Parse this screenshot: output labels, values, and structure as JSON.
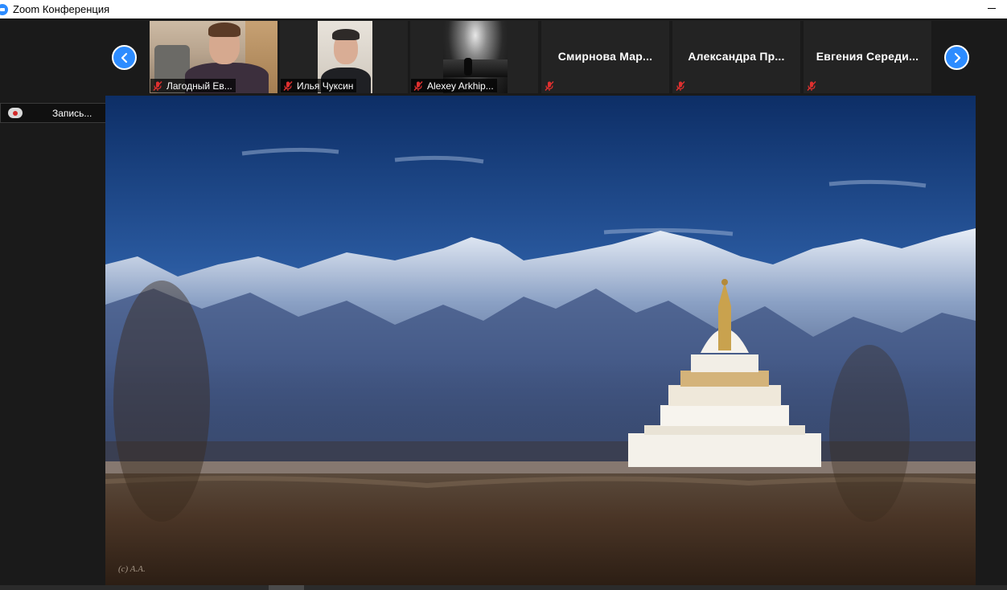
{
  "window": {
    "title": "Zoom Конференция"
  },
  "participants": [
    {
      "name": "Лагодный Ев...",
      "muted": true,
      "video": true
    },
    {
      "name": "Илья Чуксин",
      "muted": true,
      "video": true
    },
    {
      "name": "Alexey Arkhip...",
      "muted": true,
      "video": true
    },
    {
      "name": "Смирнова Мар...",
      "muted": true,
      "video": false
    },
    {
      "name": "Александра Пр...",
      "muted": true,
      "video": false
    },
    {
      "name": "Евгения Середи...",
      "muted": true,
      "video": false
    }
  ],
  "nav": {
    "prev_icon": "chevron-left-icon",
    "next_icon": "chevron-right-icon"
  },
  "recording": {
    "label": "Запись..."
  },
  "shared_content": {
    "watermark": "(c) A.A."
  },
  "colors": {
    "accent": "#2d8cff",
    "muted": "#e0302f",
    "background": "#1a1a1a",
    "titlebar": "#ffffff"
  }
}
